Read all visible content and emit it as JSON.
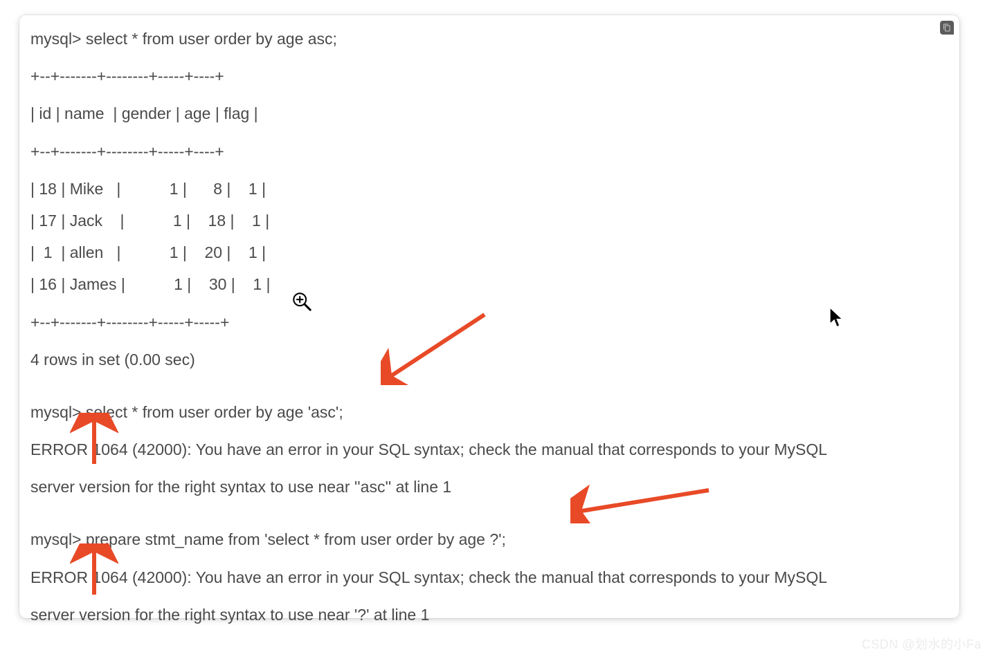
{
  "terminal": {
    "q1": "mysql> select * from user order by age asc;",
    "sep1": "+--+-------+--------+-----+----+",
    "head": "| id | name  | gender | age | flag |",
    "sep2": "+--+-------+--------+-----+----+",
    "r1": "| 18 | Mike   |           1 |      8 |    1 |",
    "r2": "| 17 | Jack    |           1 |    18 |    1 |",
    "r3": "|  1  | allen   |           1 |    20 |    1 |",
    "r4": "| 16 | James |           1 |    30 |    1 |",
    "sep3": "+--+-------+--------+-----+-----+",
    "rowcount": "4 rows in set (0.00 sec)",
    "q2": "mysql> select * from user order by age 'asc';",
    "e2a": "ERROR 1064 (42000): You have an error in your SQL syntax; check the manual that corresponds to your MySQL",
    "e2b": "server version for the right syntax to use near ''asc'' at line 1",
    "q3": "mysql> prepare stmt_name from 'select * from user order by age ?';",
    "e3a": "ERROR 1064 (42000): You have an error in your SQL syntax; check the manual that corresponds to your MySQL",
    "e3b": "server version for the right syntax to use near '?' at line 1"
  },
  "watermark": "CSDN @划水的小Fa"
}
